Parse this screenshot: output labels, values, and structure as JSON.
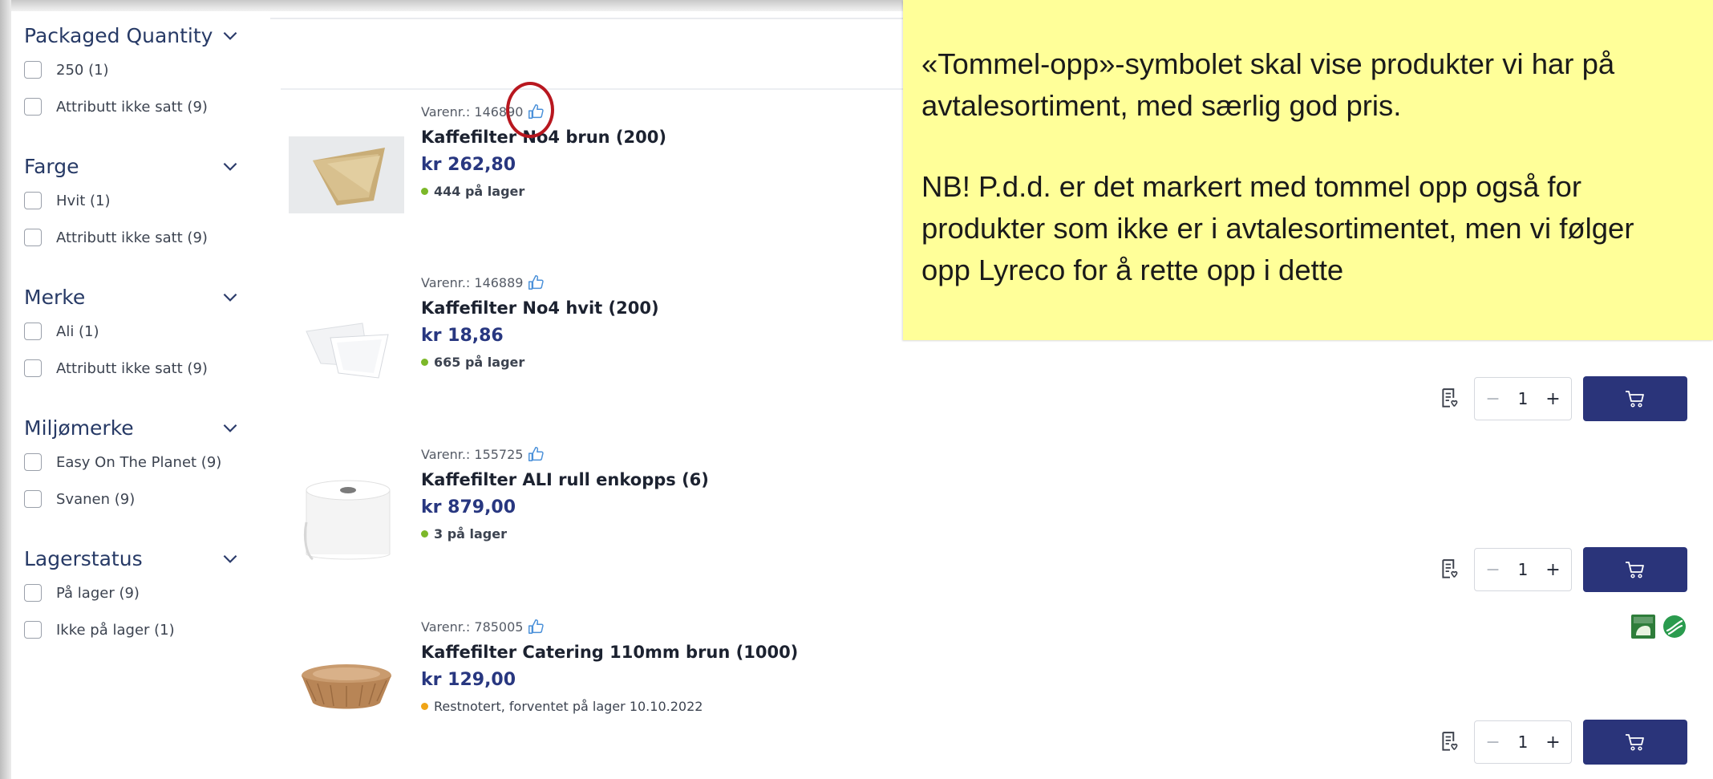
{
  "filters": [
    {
      "title": "Packaged Quantity",
      "options": [
        "250 (1)",
        "Attributt ikke satt (9)"
      ]
    },
    {
      "title": "Farge",
      "options": [
        "Hvit (1)",
        "Attributt ikke satt (9)"
      ]
    },
    {
      "title": "Merke",
      "options": [
        "Ali (1)",
        "Attributt ikke satt (9)"
      ]
    },
    {
      "title": "Miljømerke",
      "options": [
        "Easy On The Planet (9)",
        "Svanen (9)"
      ]
    },
    {
      "title": "Lagerstatus",
      "options": [
        "På lager (9)",
        "Ikke på lager (1)"
      ]
    }
  ],
  "products": [
    {
      "varenr": "Varenr.: 146890",
      "name": "Kaffefilter No4 brun (200)",
      "price": "kr 262,80",
      "stock": "444 på lager"
    },
    {
      "varenr": "Varenr.: 146889",
      "name": "Kaffefilter No4 hvit (200)",
      "price": "kr 18,86",
      "stock": "665 på lager"
    },
    {
      "varenr": "Varenr.: 155725",
      "name": "Kaffefilter ALI rull enkopps (6)",
      "price": "kr 879,00",
      "stock": "3 på lager"
    },
    {
      "varenr": "Varenr.: 785005",
      "name": "Kaffefilter Catering 110mm brun (1000)",
      "price": "kr 129,00",
      "stock": "Restnotert, forventet på lager 10.10.2022"
    }
  ],
  "qty_value": "1",
  "qty_minus": "−",
  "qty_plus": "+",
  "note": {
    "paragraph1": "«Tommel-opp»-symbolet skal vise produkter vi har på\navtalesortiment, med særlig god pris.",
    "paragraph2": "NB! P.d.d. er det markert med tommel opp også for\nprodukter som ikke er i avtalesortimentet, men vi følger\nopp Lyreco for å rette opp i dette"
  },
  "colors": {
    "accent": "#2a347a",
    "price": "#283780",
    "in_stock": "#7cb829",
    "backorder": "#f0a416",
    "note_bg": "#ffff99",
    "highlight_circle": "#b8171f",
    "thumb_icon": "#4a90d9"
  },
  "icons": [
    "chevron-down-icon",
    "thumbs-up-icon",
    "shopping-list-icon",
    "cart-icon",
    "easy-on-the-planet-icon",
    "svanen-icon"
  ]
}
